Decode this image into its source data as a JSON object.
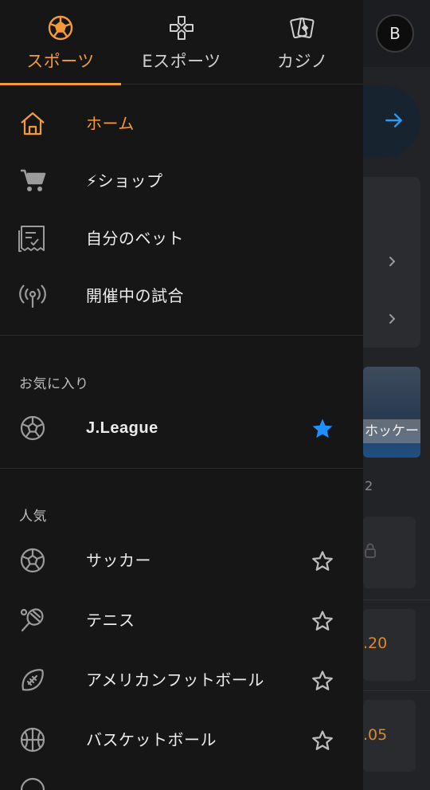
{
  "tabs": [
    {
      "label": "スポーツ",
      "icon": "soccer-ball-icon",
      "active": true
    },
    {
      "label": "Eスポーツ",
      "icon": "gamepad-icon",
      "active": false
    },
    {
      "label": "カジノ",
      "icon": "playing-cards-icon",
      "active": false
    }
  ],
  "menu": [
    {
      "label": "ホーム",
      "icon": "home-icon",
      "active": true
    },
    {
      "label": "⚡ショップ",
      "icon": "cart-icon"
    },
    {
      "label": "自分のベット",
      "icon": "bet-slip-icon"
    },
    {
      "label": "開催中の試合",
      "icon": "live-broadcast-icon"
    }
  ],
  "favorites": {
    "title": "お気に入り",
    "items": [
      {
        "label": "J.League",
        "icon": "soccer-ball-icon",
        "starred": true
      }
    ]
  },
  "popular": {
    "title": "人気",
    "items": [
      {
        "label": "サッカー",
        "icon": "soccer-ball-icon",
        "starred": false
      },
      {
        "label": "テニス",
        "icon": "tennis-racket-icon",
        "starred": false
      },
      {
        "label": "アメリカンフットボール",
        "icon": "american-football-icon",
        "starred": false
      },
      {
        "label": "バスケットボール",
        "icon": "basketball-icon",
        "starred": false
      }
    ]
  },
  "background": {
    "avatar_initial": "B",
    "image_label": "ホッケー",
    "counter": "2",
    "odds": [
      ".20",
      ".05"
    ]
  },
  "colors": {
    "accent": "#f39a39",
    "star_filled": "#1e90ff",
    "drawer_bg": "#161616"
  }
}
